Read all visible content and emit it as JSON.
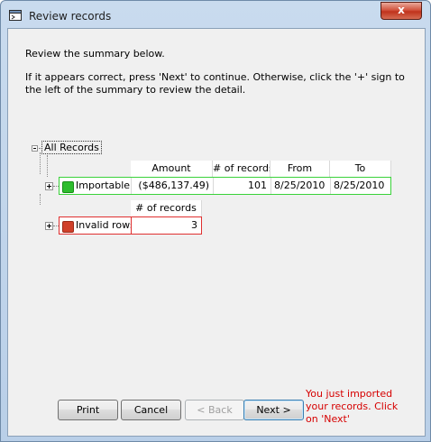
{
  "window": {
    "title": "Review records",
    "close_glyph": "x"
  },
  "intro": {
    "line1": "Review the summary below.",
    "line2": "If it appears correct, press 'Next' to continue.  Otherwise, click the '+' sign to",
    "line3": "the left of the summary to review the detail."
  },
  "tree": {
    "root_label": "All Records",
    "importable": {
      "headers": [
        "Amount",
        "# of records",
        "From",
        "To"
      ],
      "label": "Importable",
      "amount": "($486,137.49)",
      "records": "101",
      "from": "8/25/2010",
      "to": "8/25/2010",
      "status_color": "#2ebd2e",
      "border_color": "#3ad23a"
    },
    "invalid": {
      "headers": [
        "# of records"
      ],
      "label": "Invalid rows",
      "records": "3",
      "status_color": "#d0402a",
      "border_color": "#e03030"
    }
  },
  "buttons": {
    "print": "Print",
    "cancel": "Cancel",
    "back": "< Back",
    "next": "Next >"
  },
  "note": {
    "lines": [
      "You just imported",
      "your records. Click",
      "on 'Next'"
    ],
    "color": "#d60000"
  }
}
